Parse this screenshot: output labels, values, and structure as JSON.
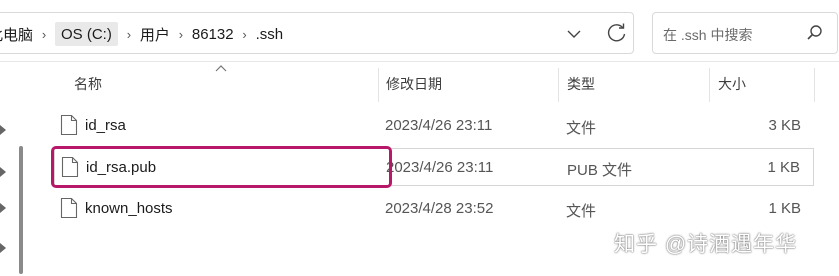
{
  "address_bar": {
    "breadcrumbs": [
      "此电脑",
      "OS (C:)",
      "用户",
      "86132",
      ".ssh"
    ]
  },
  "search": {
    "placeholder": "在 .ssh 中搜索"
  },
  "columns": {
    "name": "名称",
    "modified": "修改日期",
    "type": "类型",
    "size": "大小"
  },
  "files": [
    {
      "name": "id_rsa",
      "modified": "2023/4/26 23:11",
      "type": "文件",
      "size": "3 KB"
    },
    {
      "name": "id_rsa.pub",
      "modified": "2023/4/26 23:11",
      "type": "PUB 文件",
      "size": "1 KB"
    },
    {
      "name": "known_hosts",
      "modified": "2023/4/28 23:52",
      "type": "文件",
      "size": "1 KB"
    }
  ],
  "watermark": "知乎 @诗酒遇年华",
  "colors": {
    "highlight_border": "#b8186a",
    "scrollbar": "#8a8a8a"
  }
}
